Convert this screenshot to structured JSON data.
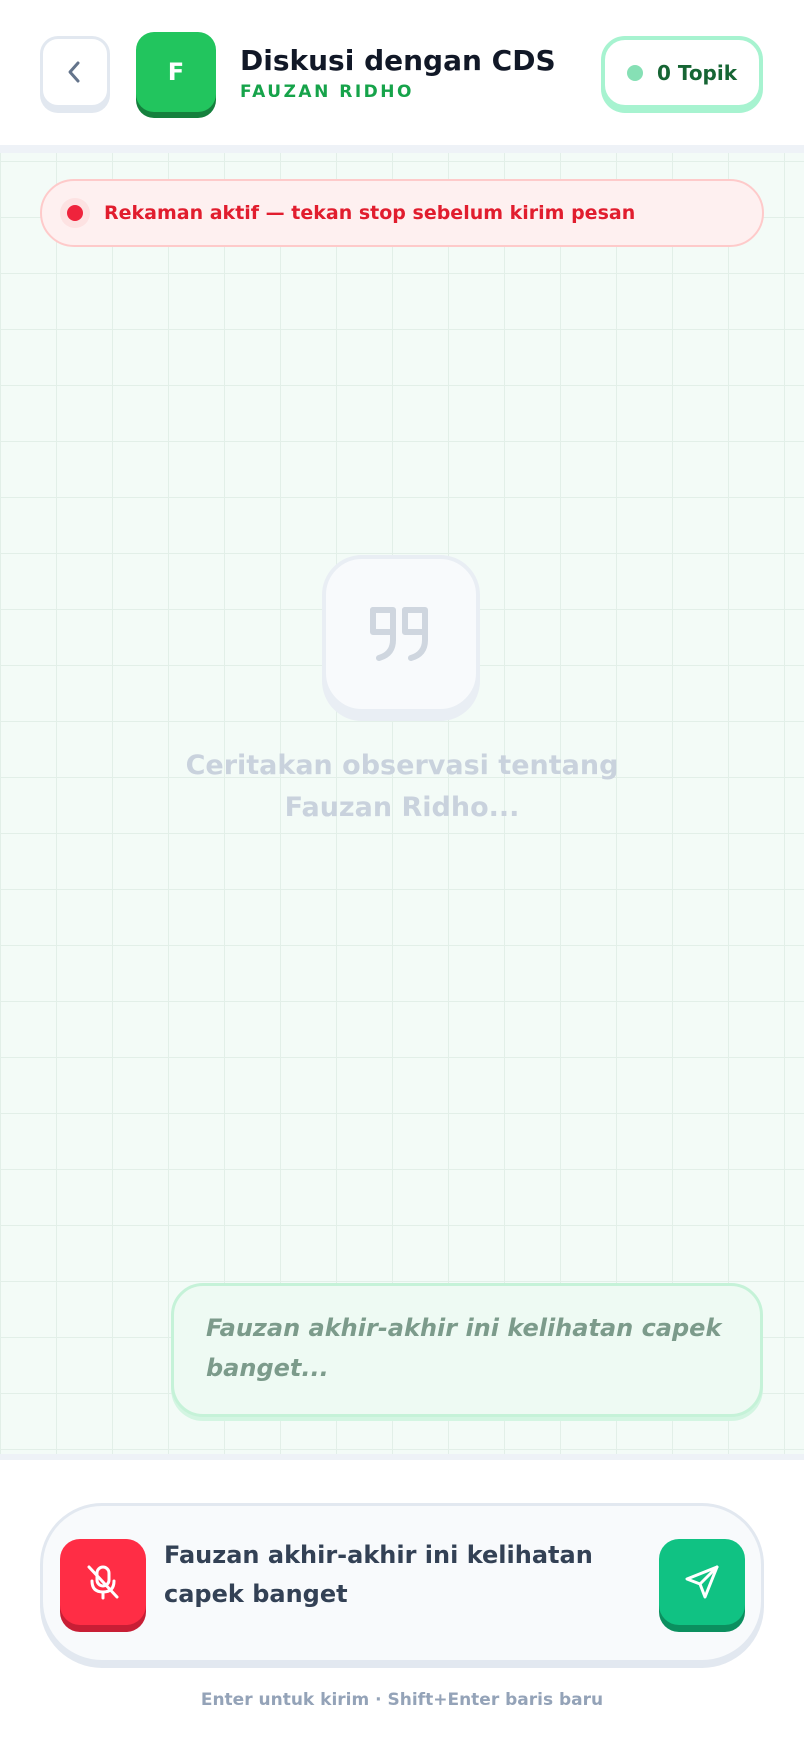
{
  "header": {
    "back_icon": "chevron-left-icon",
    "avatar_initial": "F",
    "title": "Diskusi dengan CDS",
    "subtitle": "FAUZAN RIDHO",
    "topic_count_label": "0 Topik"
  },
  "recording_banner": {
    "text": "Rekaman aktif — tekan stop sebelum kirim pesan"
  },
  "empty_state": {
    "icon": "quote-icon",
    "text": "Ceritakan observasi tentang Fauzan Ridho..."
  },
  "preview": {
    "text": "Fauzan akhir-akhir ini kelihatan capek banget..."
  },
  "composer": {
    "mic_icon": "mic-off-icon",
    "send_icon": "send-icon",
    "value": "Fauzan akhir-akhir ini kelihatan capek banget",
    "hint": "Enter untuk kirim · Shift+Enter baris baru"
  },
  "colors": {
    "accent_green": "#22c55e",
    "record_red": "#ef233c",
    "send_green": "#10c283",
    "mic_red": "#ff2d45"
  }
}
